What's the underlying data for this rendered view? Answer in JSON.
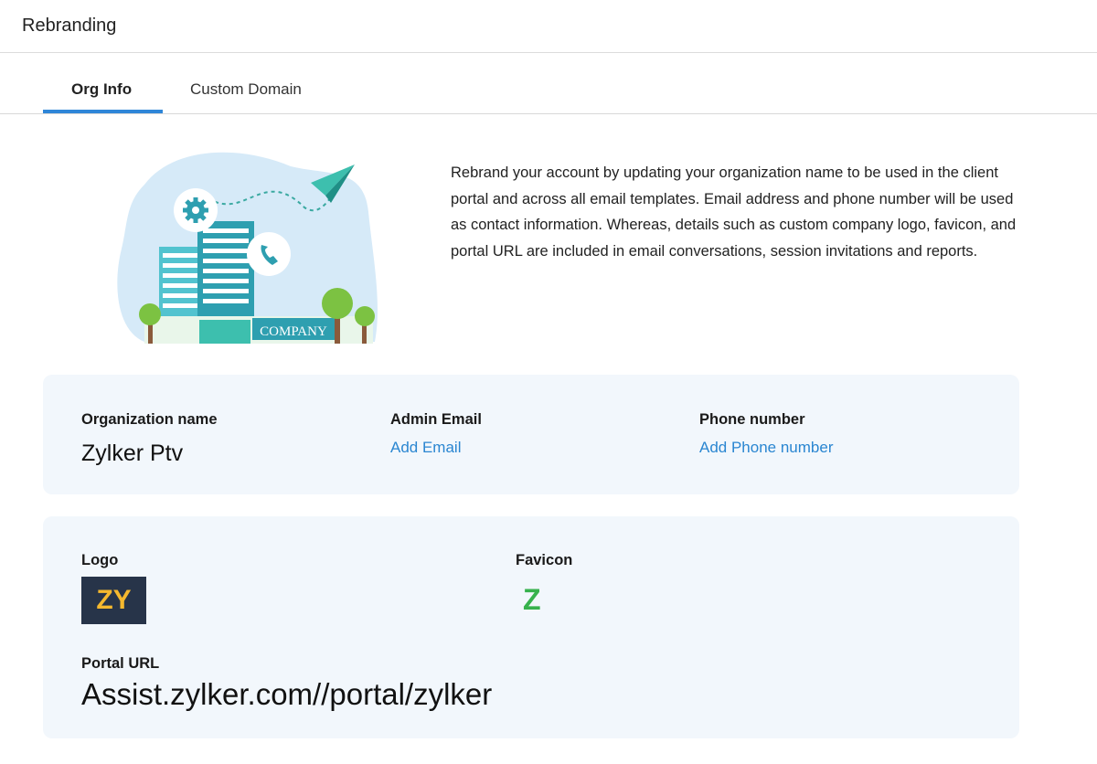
{
  "header": {
    "title": "Rebranding"
  },
  "tabs": [
    {
      "label": "Org Info",
      "active": true
    },
    {
      "label": "Custom Domain",
      "active": false
    }
  ],
  "illustration": {
    "company_label": "COMPANY"
  },
  "description": "Rebrand your account by updating your organization name to be used in the client portal and across all email templates. Email address and phone number will be used as contact information. Whereas, details such as custom company logo, favicon, and portal URL are included in email conversations, session invitations and reports.",
  "org_card": {
    "org_name_label": "Organization name",
    "org_name_value": "Zylker Ptv",
    "admin_email_label": "Admin Email",
    "admin_email_action": "Add Email",
    "phone_label": "Phone number",
    "phone_action": "Add Phone number"
  },
  "branding_card": {
    "logo_label": "Logo",
    "logo_text": "ZY",
    "favicon_label": "Favicon",
    "favicon_text": "Z",
    "portal_url_label": "Portal URL",
    "portal_url_value": "Assist.zylker.com//portal/zylker"
  },
  "colors": {
    "accent": "#2f86d8",
    "link": "#2a86d1",
    "card_bg": "#f2f7fc",
    "logo_bg": "#273449",
    "logo_fg": "#f5b82e",
    "favicon_fg": "#37b24d"
  }
}
